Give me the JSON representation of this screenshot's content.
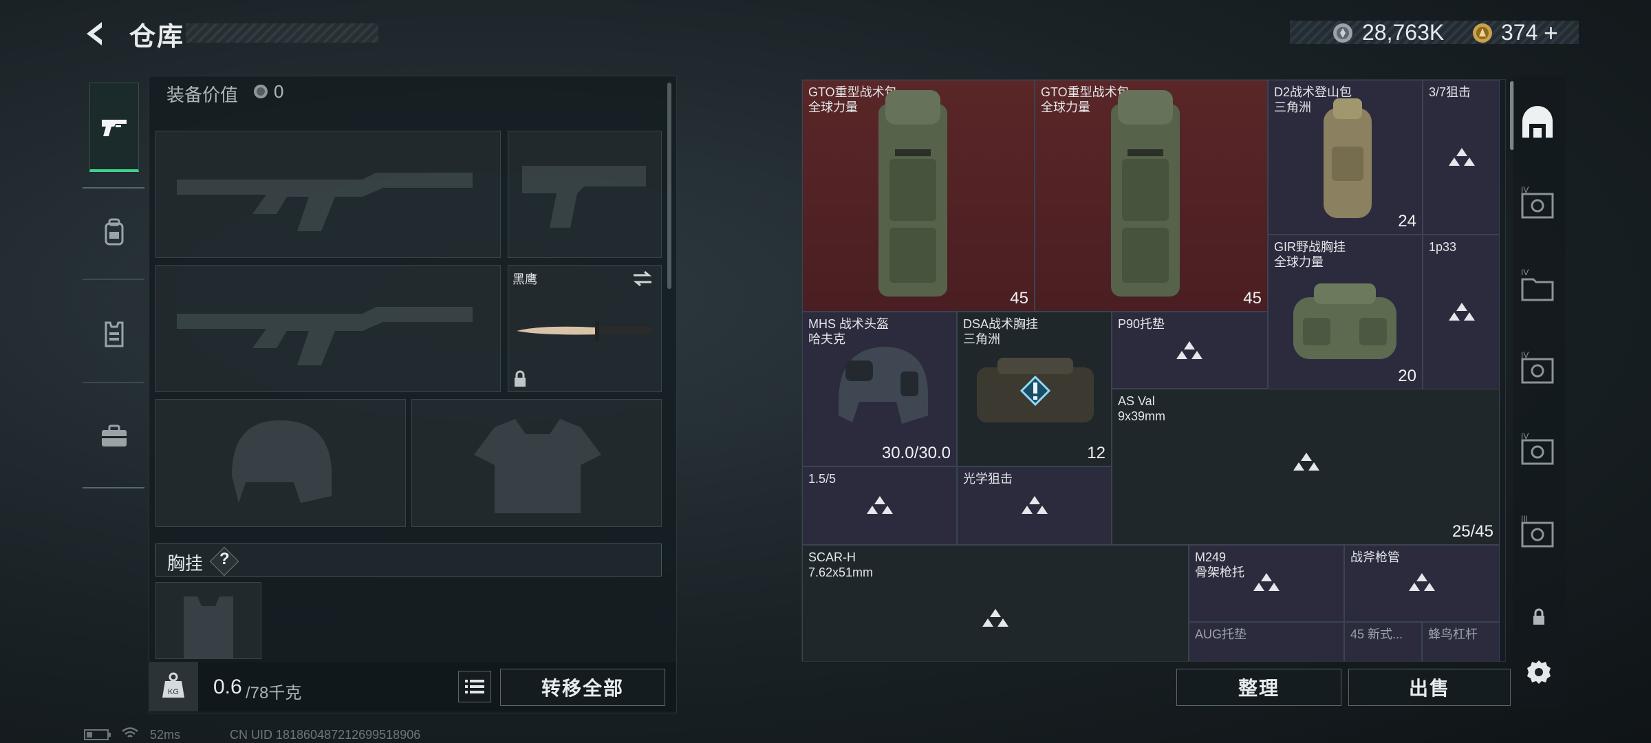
{
  "header": {
    "title": "仓库",
    "currency_silver": "28,763K",
    "currency_gold": "374",
    "gold_plus": "+"
  },
  "loadout": {
    "equipment_value_label": "装备价值",
    "equipment_value": "0",
    "knife_name": "黑鹰",
    "chest_rig_label": "胸挂",
    "help_mark": "?",
    "weight_current": "0.6",
    "weight_max": "/78千克",
    "transfer_all_label": "转移全部",
    "kg_label": "KG"
  },
  "storage": {
    "items": [
      {
        "name": "GTO重型战术包\n全球力量",
        "count": "45"
      },
      {
        "name": "GTO重型战术包\n全球力量",
        "count": "45"
      },
      {
        "name": "D2战术登山包\n三角洲",
        "count": "24"
      },
      {
        "name": "3/7狙击"
      },
      {
        "name": "GIR野战胸挂\n全球力量",
        "count": "20"
      },
      {
        "name": "1p33"
      },
      {
        "name": "MHS 战术头盔\n哈夫克",
        "count": "30.0/30.0"
      },
      {
        "name": "DSA战术胸挂\n三角洲",
        "count": "12"
      },
      {
        "name": "P90托垫"
      },
      {
        "name": "AS Val\n9x39mm",
        "count": "25/45"
      },
      {
        "name": "1.5/5"
      },
      {
        "name": "光学狙击"
      },
      {
        "name": "SCAR-H\n7.62x51mm"
      },
      {
        "name": "M249\n骨架枪托"
      },
      {
        "name": "战斧枪管"
      },
      {
        "name": "AUG托垫"
      },
      {
        "name": "45 新式..."
      },
      {
        "name": "蜂鸟杠杆"
      }
    ],
    "sort_label": "整理",
    "sell_label": "出售"
  },
  "status_bar": {
    "ping": "52ms",
    "uid": "CN UID 181860487212699518906"
  },
  "rail": {
    "tier_labels": [
      "IV",
      "IV",
      "IV",
      "IV",
      "III"
    ]
  },
  "colors": {
    "accent_green": "#3fd38a",
    "red_rarity": "#5a2628",
    "purple_rarity": "#2c2b3e"
  }
}
